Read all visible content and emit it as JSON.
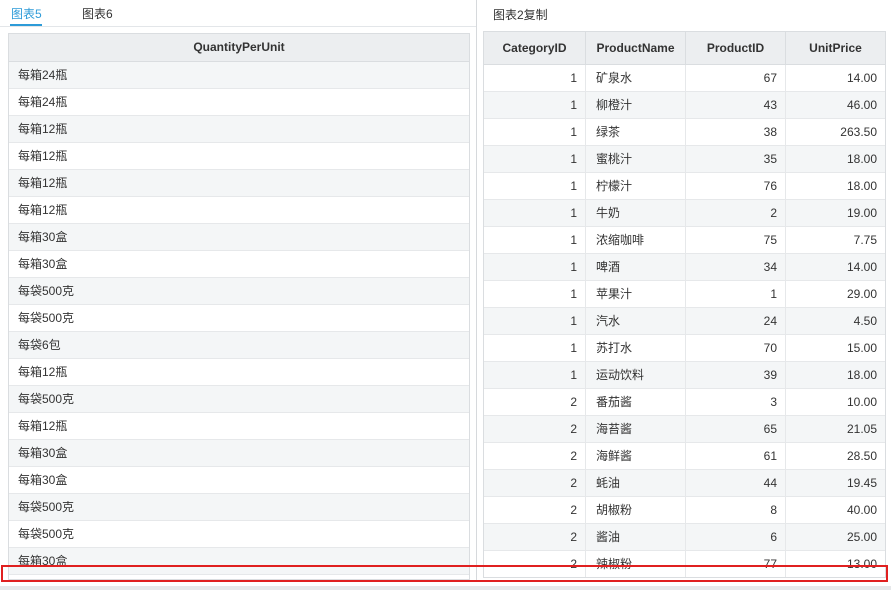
{
  "left_tabs": [
    {
      "label": "图表5",
      "active": true
    },
    {
      "label": "图表6",
      "active": false
    }
  ],
  "left_table": {
    "header": "QuantityPerUnit",
    "rows": [
      "每箱24瓶",
      "每箱24瓶",
      "每箱12瓶",
      "每箱12瓶",
      "每箱12瓶",
      "每箱12瓶",
      "每箱30盒",
      "每箱30盒",
      "每袋500克",
      "每袋500克",
      "每袋6包",
      "每箱12瓶",
      "每袋500克",
      "每箱12瓶",
      "每箱30盒",
      "每箱30盒",
      "每袋500克",
      "每袋500克",
      "每箱30盒"
    ]
  },
  "right_title": "图表2复制",
  "right_table": {
    "headers": [
      "CategoryID",
      "ProductName",
      "ProductID",
      "UnitPrice"
    ],
    "rows": [
      [
        "1",
        "矿泉水",
        "67",
        "14.00"
      ],
      [
        "1",
        "柳橙汁",
        "43",
        "46.00"
      ],
      [
        "1",
        "绿茶",
        "38",
        "263.50"
      ],
      [
        "1",
        "蜜桃汁",
        "35",
        "18.00"
      ],
      [
        "1",
        "柠檬汁",
        "76",
        "18.00"
      ],
      [
        "1",
        "牛奶",
        "2",
        "19.00"
      ],
      [
        "1",
        "浓缩咖啡",
        "75",
        "7.75"
      ],
      [
        "1",
        "啤酒",
        "34",
        "14.00"
      ],
      [
        "1",
        "苹果汁",
        "1",
        "29.00"
      ],
      [
        "1",
        "汽水",
        "24",
        "4.50"
      ],
      [
        "1",
        "苏打水",
        "70",
        "15.00"
      ],
      [
        "1",
        "运动饮料",
        "39",
        "18.00"
      ],
      [
        "2",
        "番茄酱",
        "3",
        "10.00"
      ],
      [
        "2",
        "海苔酱",
        "65",
        "21.05"
      ],
      [
        "2",
        "海鲜酱",
        "61",
        "28.50"
      ],
      [
        "2",
        "蚝油",
        "44",
        "19.45"
      ],
      [
        "2",
        "胡椒粉",
        "8",
        "40.00"
      ],
      [
        "2",
        "酱油",
        "6",
        "25.00"
      ],
      [
        "2",
        "辣椒粉",
        "77",
        "13.00"
      ]
    ]
  },
  "colors": {
    "accent": "#2d9bd8",
    "highlight": "#e02020",
    "header_bg": "#eceef0"
  }
}
